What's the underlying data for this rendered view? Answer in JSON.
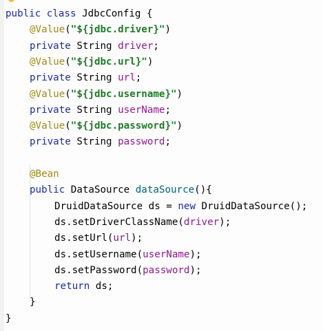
{
  "editor": {
    "lines": [
      {
        "indent": 0,
        "tokens": [
          {
            "t": "public",
            "c": "kw"
          },
          {
            "t": " ",
            "c": "pl"
          },
          {
            "t": "class",
            "c": "kw"
          },
          {
            "t": " ",
            "c": "pl"
          },
          {
            "t": "JdbcConfig",
            "c": "typ"
          },
          {
            "t": " {",
            "c": "pl"
          }
        ]
      },
      {
        "indent": 1,
        "tokens": [
          {
            "t": "@Value",
            "c": "ann"
          },
          {
            "t": "(",
            "c": "pl"
          },
          {
            "t": "\"${jdbc.driver}\"",
            "c": "str"
          },
          {
            "t": ")",
            "c": "pl"
          }
        ]
      },
      {
        "indent": 1,
        "tokens": [
          {
            "t": "private",
            "c": "kw"
          },
          {
            "t": " String ",
            "c": "pl"
          },
          {
            "t": "driver",
            "c": "fld"
          },
          {
            "t": ";",
            "c": "pl"
          }
        ]
      },
      {
        "indent": 1,
        "tokens": [
          {
            "t": "@Value",
            "c": "ann"
          },
          {
            "t": "(",
            "c": "pl"
          },
          {
            "t": "\"${jdbc.url}\"",
            "c": "str"
          },
          {
            "t": ")",
            "c": "pl"
          }
        ]
      },
      {
        "indent": 1,
        "tokens": [
          {
            "t": "private",
            "c": "kw"
          },
          {
            "t": " String ",
            "c": "pl"
          },
          {
            "t": "url",
            "c": "fld"
          },
          {
            "t": ";",
            "c": "pl"
          }
        ]
      },
      {
        "indent": 1,
        "tokens": [
          {
            "t": "@Value",
            "c": "ann"
          },
          {
            "t": "(",
            "c": "pl"
          },
          {
            "t": "\"${jdbc.username}\"",
            "c": "str"
          },
          {
            "t": ")",
            "c": "pl"
          }
        ]
      },
      {
        "indent": 1,
        "tokens": [
          {
            "t": "private",
            "c": "kw"
          },
          {
            "t": " String ",
            "c": "pl"
          },
          {
            "t": "userName",
            "c": "fld"
          },
          {
            "t": ";",
            "c": "pl"
          }
        ]
      },
      {
        "indent": 1,
        "tokens": [
          {
            "t": "@Value",
            "c": "ann"
          },
          {
            "t": "(",
            "c": "pl"
          },
          {
            "t": "\"${jdbc.password}\"",
            "c": "str"
          },
          {
            "t": ")",
            "c": "pl"
          }
        ]
      },
      {
        "indent": 1,
        "tokens": [
          {
            "t": "private",
            "c": "kw"
          },
          {
            "t": " String ",
            "c": "pl"
          },
          {
            "t": "password",
            "c": "fld"
          },
          {
            "t": ";",
            "c": "pl"
          }
        ]
      },
      {
        "indent": 0,
        "tokens": []
      },
      {
        "indent": 1,
        "tokens": [
          {
            "t": "@Bean",
            "c": "ann"
          }
        ]
      },
      {
        "indent": 1,
        "tokens": [
          {
            "t": "public",
            "c": "kw"
          },
          {
            "t": " DataSource ",
            "c": "pl"
          },
          {
            "t": "dataSource",
            "c": "mth"
          },
          {
            "t": "(){",
            "c": "pl"
          }
        ]
      },
      {
        "indent": 2,
        "tokens": [
          {
            "t": "DruidDataSource ds = ",
            "c": "pl"
          },
          {
            "t": "new",
            "c": "kw"
          },
          {
            "t": " DruidDataSource();",
            "c": "pl"
          }
        ]
      },
      {
        "indent": 2,
        "tokens": [
          {
            "t": "ds.setDriverClassName(",
            "c": "pl"
          },
          {
            "t": "driver",
            "c": "fld"
          },
          {
            "t": ");",
            "c": "pl"
          }
        ]
      },
      {
        "indent": 2,
        "tokens": [
          {
            "t": "ds.setUrl(",
            "c": "pl"
          },
          {
            "t": "url",
            "c": "fld"
          },
          {
            "t": ");",
            "c": "pl"
          }
        ]
      },
      {
        "indent": 2,
        "tokens": [
          {
            "t": "ds.setUsername(",
            "c": "pl"
          },
          {
            "t": "userName",
            "c": "fld"
          },
          {
            "t": ");",
            "c": "pl"
          }
        ]
      },
      {
        "indent": 2,
        "tokens": [
          {
            "t": "ds.setPassword(",
            "c": "pl"
          },
          {
            "t": "password",
            "c": "fld"
          },
          {
            "t": ");",
            "c": "pl"
          }
        ]
      },
      {
        "indent": 2,
        "tokens": [
          {
            "t": "return",
            "c": "kw"
          },
          {
            "t": " ds;",
            "c": "pl"
          }
        ]
      },
      {
        "indent": 1,
        "tokens": [
          {
            "t": "}",
            "c": "pl"
          }
        ]
      },
      {
        "indent": 0,
        "tokens": [
          {
            "t": "}",
            "c": "pl"
          }
        ]
      }
    ]
  },
  "colors": {
    "keyword": "#1d2b9e",
    "annotation": "#9b8a1a",
    "string": "#1f7a28",
    "field": "#8a1c8a",
    "method": "#00627a",
    "background": "#fdfdfd"
  },
  "icons": {
    "gutter_hint": "lightbulb-icon"
  }
}
